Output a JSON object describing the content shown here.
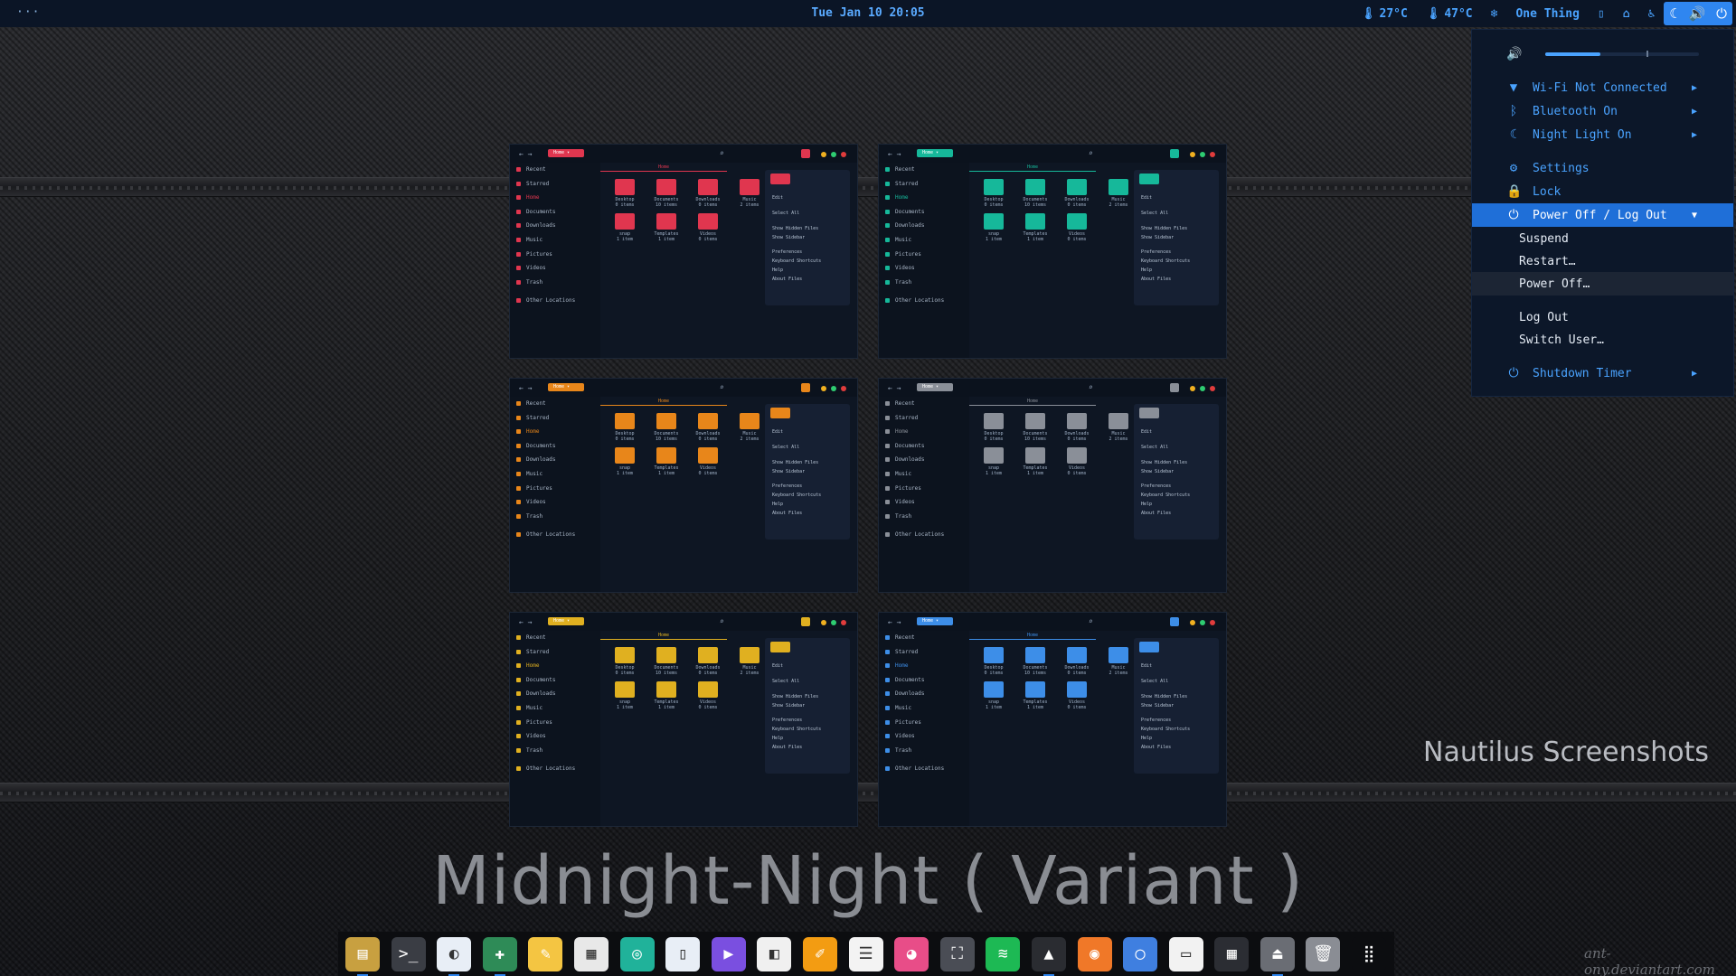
{
  "topbar": {
    "dots": "···",
    "clock": "Tue Jan 10 20:05",
    "temp1": "27°C",
    "temp2": "47°C",
    "weather_icon": "snowflake-icon",
    "one_thing": "One Thing"
  },
  "quick_settings": {
    "volume_level": 0.36,
    "items": [
      {
        "icon": "wifi-icon",
        "label": "Wi-Fi Not Connected"
      },
      {
        "icon": "bluetooth-icon",
        "label": "Bluetooth On"
      },
      {
        "icon": "night-light-icon",
        "label": "Night Light On"
      },
      {
        "icon": "settings-icon",
        "label": "Settings"
      },
      {
        "icon": "lock-icon",
        "label": "Lock"
      },
      {
        "icon": "power-icon",
        "label": "Power Off / Log Out"
      }
    ],
    "power_submenu": [
      "Suspend",
      "Restart…",
      "Power Off…",
      "Log Out",
      "Switch User…"
    ],
    "shutdown_timer": "Shutdown Timer"
  },
  "windows": {
    "accents": [
      "#e0364f",
      "#16b89a",
      "#e8861a",
      "#8a8f98",
      "#e0b020",
      "#3d8ee8"
    ],
    "home_pill": "Home",
    "home_tab": "Home",
    "sidebar": [
      "Recent",
      "Starred",
      "Home",
      "Documents",
      "Downloads",
      "Music",
      "Pictures",
      "Videos",
      "Trash",
      "Other Locations"
    ],
    "folders": [
      {
        "name": "Desktop",
        "count": "0 items"
      },
      {
        "name": "Documents",
        "count": "10 items"
      },
      {
        "name": "Downloads",
        "count": "0 items"
      },
      {
        "name": "Music",
        "count": "2 items"
      },
      {
        "name": "snap",
        "count": "1 item"
      },
      {
        "name": "Templates",
        "count": "1 item"
      },
      {
        "name": "Videos",
        "count": "0 items"
      }
    ],
    "menu": [
      "Edit",
      "Select All",
      "Show Hidden Files",
      "Show Sidebar",
      "Preferences",
      "Keyboard Shortcuts",
      "Help",
      "About Files"
    ]
  },
  "subtitle": "Nautilus Screenshots",
  "title": "Midnight-Night ( Variant )",
  "signature": "ant-ony.deviantart.com",
  "dock": [
    {
      "icon": "files-icon",
      "color": "#c8a040",
      "running": true
    },
    {
      "icon": "terminal-icon",
      "color": "#3a3d44",
      "running": false
    },
    {
      "icon": "toggle-icon",
      "color": "#e8eef6",
      "running": true
    },
    {
      "icon": "gnome-tweaks-icon",
      "color": "#2e8b57",
      "running": true
    },
    {
      "icon": "text-editor-icon",
      "color": "#f4c542",
      "running": false
    },
    {
      "icon": "calendar-icon",
      "color": "#e8e8e8",
      "running": false
    },
    {
      "icon": "aperture-icon",
      "color": "#20b29a",
      "running": false
    },
    {
      "icon": "document-icon",
      "color": "#e8eef6",
      "running": false
    },
    {
      "icon": "play-store-icon",
      "color": "#7a4fe0",
      "running": false
    },
    {
      "icon": "software-icon",
      "color": "#f0f0f0",
      "running": false
    },
    {
      "icon": "color-picker-icon",
      "color": "#f39c12",
      "running": false
    },
    {
      "icon": "clipboard-icon",
      "color": "#f3f3f3",
      "running": false
    },
    {
      "icon": "color-wheel-icon",
      "color": "#e84d88",
      "running": false
    },
    {
      "icon": "screenshot-icon",
      "color": "#4a4d55",
      "running": false
    },
    {
      "icon": "spotify-icon",
      "color": "#1db954",
      "running": false
    },
    {
      "icon": "inkscape-icon",
      "color": "#2a2c31",
      "running": true
    },
    {
      "icon": "firefox-icon",
      "color": "#f07828",
      "running": false
    },
    {
      "icon": "chromium-icon",
      "color": "#3f7fe0",
      "running": false
    },
    {
      "icon": "news-icon",
      "color": "#f2f2f2",
      "running": false
    },
    {
      "icon": "calculator-icon",
      "color": "#2b2d33",
      "running": false
    },
    {
      "icon": "eject-icon",
      "color": "#6a6d74",
      "running": true
    },
    {
      "icon": "trash-icon",
      "color": "#8a8d94",
      "running": false
    },
    {
      "icon": "app-grid-icon",
      "color": "#0c0d10",
      "running": false
    }
  ]
}
